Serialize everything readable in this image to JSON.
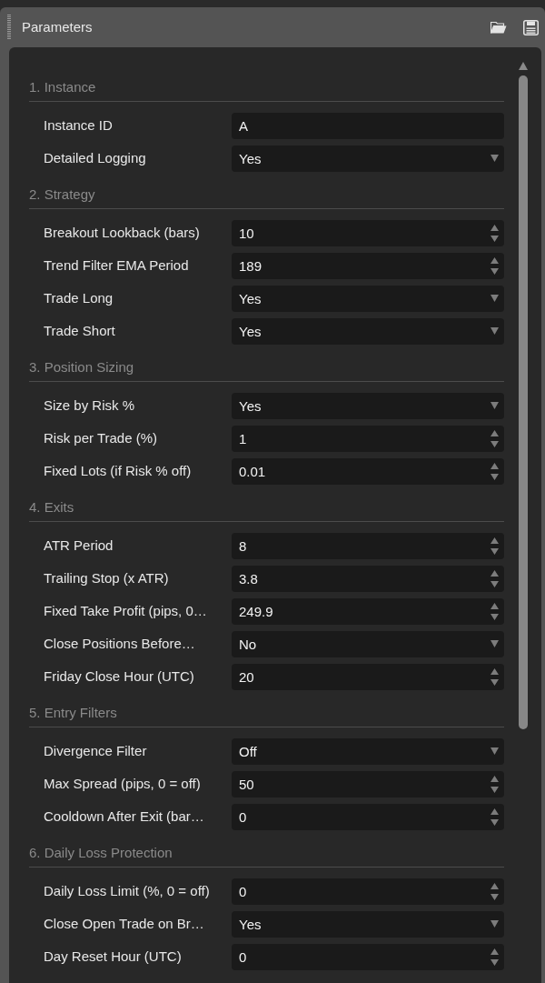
{
  "panel": {
    "title": "Parameters"
  },
  "sections": [
    {
      "title": "1. Instance",
      "params": [
        {
          "label": "Instance ID",
          "kind": "text",
          "value": "A"
        },
        {
          "label": "Detailed Logging",
          "kind": "select",
          "value": "Yes"
        }
      ]
    },
    {
      "title": "2. Strategy",
      "params": [
        {
          "label": "Breakout Lookback (bars)",
          "kind": "number",
          "value": "10"
        },
        {
          "label": "Trend Filter EMA Period",
          "kind": "number",
          "value": "189"
        },
        {
          "label": "Trade Long",
          "kind": "select",
          "value": "Yes"
        },
        {
          "label": "Trade Short",
          "kind": "select",
          "value": "Yes"
        }
      ]
    },
    {
      "title": "3. Position Sizing",
      "params": [
        {
          "label": "Size by Risk %",
          "kind": "select",
          "value": "Yes"
        },
        {
          "label": "Risk per Trade (%)",
          "kind": "number",
          "value": "1"
        },
        {
          "label": "Fixed Lots (if Risk % off)",
          "kind": "number",
          "value": "0.01"
        }
      ]
    },
    {
      "title": "4. Exits",
      "params": [
        {
          "label": "ATR Period",
          "kind": "number",
          "value": "8"
        },
        {
          "label": "Trailing Stop (x ATR)",
          "kind": "number",
          "value": "3.8"
        },
        {
          "label": "Fixed Take Profit (pips, 0…",
          "kind": "number",
          "value": "249.9"
        },
        {
          "label": "Close Positions Before…",
          "kind": "select",
          "value": "No"
        },
        {
          "label": "Friday Close Hour (UTC)",
          "kind": "number",
          "value": "20"
        }
      ]
    },
    {
      "title": "5. Entry Filters",
      "params": [
        {
          "label": "Divergence Filter",
          "kind": "select",
          "value": "Off"
        },
        {
          "label": "Max Spread (pips, 0 = off)",
          "kind": "number",
          "value": "50"
        },
        {
          "label": "Cooldown After Exit (bar…",
          "kind": "number",
          "value": "0"
        }
      ]
    },
    {
      "title": "6. Daily Loss Protection",
      "params": [
        {
          "label": "Daily Loss Limit (%, 0 = off)",
          "kind": "number",
          "value": "0"
        },
        {
          "label": "Close Open Trade on Br…",
          "kind": "select",
          "value": "Yes"
        },
        {
          "label": "Day Reset Hour (UTC)",
          "kind": "number",
          "value": "0"
        }
      ]
    }
  ]
}
